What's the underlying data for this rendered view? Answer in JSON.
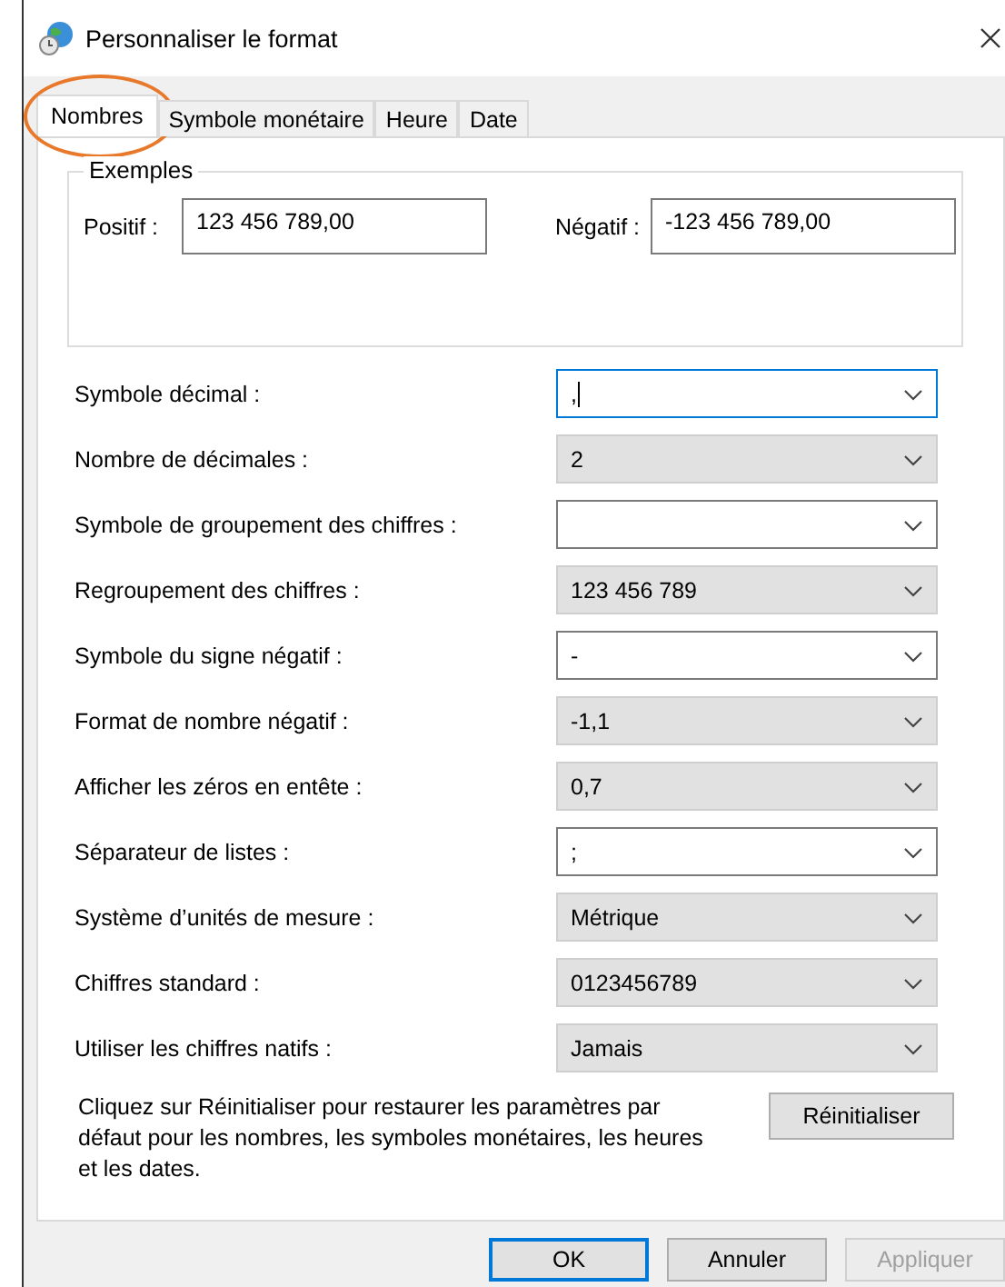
{
  "window": {
    "title": "Personnaliser le format"
  },
  "tabs": [
    {
      "label": "Nombres",
      "selected": true,
      "highlighted": true
    },
    {
      "label": "Symbole monétaire",
      "selected": false,
      "highlighted": false
    },
    {
      "label": "Heure",
      "selected": false,
      "highlighted": false
    },
    {
      "label": "Date",
      "selected": false,
      "highlighted": false
    }
  ],
  "examples": {
    "title": "Exemples",
    "positive_label": "Positif :",
    "positive_value": "123 456 789,00",
    "negative_label": "Négatif :",
    "negative_value": "-123 456 789,00"
  },
  "settings": [
    {
      "label": "Symbole décimal :",
      "value": ",",
      "kind": "combo",
      "focused": true
    },
    {
      "label": "Nombre de décimales :",
      "value": "2",
      "kind": "list",
      "focused": false
    },
    {
      "label": "Symbole de groupement des chiffres :",
      "kind": "combo",
      "focused": false
    },
    {
      "label": "Regroupement des chiffres :",
      "value": "123 456 789",
      "kind": "list",
      "focused": false
    },
    {
      "label": "Symbole du signe négatif :",
      "value": "-",
      "kind": "combo",
      "focused": false
    },
    {
      "label": "Format de nombre négatif :",
      "value": "-1,1",
      "kind": "list",
      "focused": false
    },
    {
      "label": "Afficher les zéros en entête :",
      "value": "0,7",
      "kind": "list",
      "focused": false
    },
    {
      "label": "Séparateur de listes :",
      "value": ";",
      "kind": "combo",
      "focused": false
    },
    {
      "label": "Système d’unités de mesure :",
      "value": "Métrique",
      "kind": "list",
      "focused": false
    },
    {
      "label": "Chiffres standard :",
      "value": "0123456789",
      "kind": "list",
      "focused": false
    },
    {
      "label": "Utiliser les chiffres natifs :",
      "value": "Jamais",
      "kind": "list",
      "focused": false
    }
  ],
  "reset": {
    "text": "Cliquez sur Réinitialiser pour restaurer les paramètres par défaut pour les nombres, les symboles monétaires, les heures et les dates.",
    "button": "Réinitialiser"
  },
  "buttons": [
    {
      "label": "OK",
      "default": true,
      "disabled": false
    },
    {
      "label": "Annuler",
      "default": false,
      "disabled": false
    },
    {
      "label": "Appliquer",
      "default": false,
      "disabled": true
    }
  ]
}
